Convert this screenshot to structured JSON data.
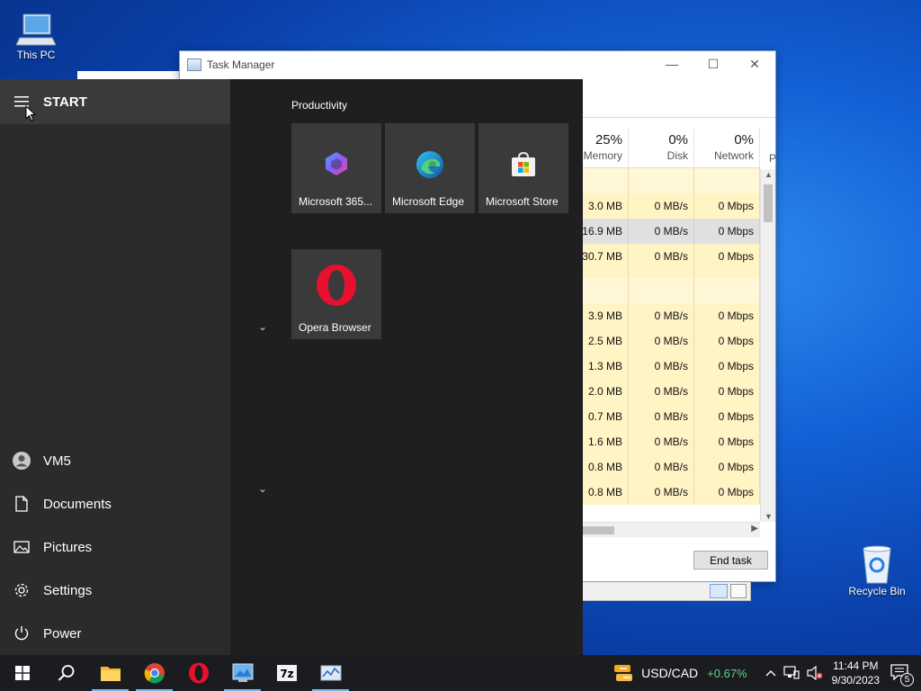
{
  "desktop": {
    "icons": [
      {
        "label": "This PC"
      },
      {
        "label": "Recycle Bin"
      }
    ]
  },
  "task_manager": {
    "title": "Task Manager",
    "columns": [
      {
        "pct": "25%",
        "label": "Memory"
      },
      {
        "pct": "0%",
        "label": "Disk"
      },
      {
        "pct": "0%",
        "label": "Network"
      }
    ],
    "truncated_column": "P",
    "rows": [
      {
        "memory": "",
        "disk": "",
        "network": ""
      },
      {
        "memory": "3.0 MB",
        "disk": "0 MB/s",
        "network": "0 Mbps"
      },
      {
        "memory": "16.9 MB",
        "disk": "0 MB/s",
        "network": "0 Mbps",
        "selected": true
      },
      {
        "memory": "30.7 MB",
        "disk": "0 MB/s",
        "network": "0 Mbps"
      },
      {
        "memory": "",
        "disk": "",
        "network": ""
      },
      {
        "memory": "3.9 MB",
        "disk": "0 MB/s",
        "network": "0 Mbps"
      },
      {
        "memory": "2.5 MB",
        "disk": "0 MB/s",
        "network": "0 Mbps"
      },
      {
        "memory": "1.3 MB",
        "disk": "0 MB/s",
        "network": "0 Mbps"
      },
      {
        "memory": "2.0 MB",
        "disk": "0 MB/s",
        "network": "0 Mbps"
      },
      {
        "memory": "0.7 MB",
        "disk": "0 MB/s",
        "network": "0 Mbps"
      },
      {
        "memory": "1.6 MB",
        "disk": "0 MB/s",
        "network": "0 Mbps"
      },
      {
        "memory": "0.8 MB",
        "disk": "0 MB/s",
        "network": "0 Mbps"
      },
      {
        "memory": "0.8 MB",
        "disk": "0 MB/s",
        "network": "0 Mbps"
      }
    ],
    "end_task_label": "End task",
    "controls": {
      "minimize": "—",
      "maximize": "☐",
      "close": "✕"
    }
  },
  "start_menu": {
    "header": "START",
    "left_items": [
      {
        "label": "VM5",
        "icon": "user-avatar-icon"
      },
      {
        "label": "Documents",
        "icon": "document-icon"
      },
      {
        "label": "Pictures",
        "icon": "pictures-icon"
      },
      {
        "label": "Settings",
        "icon": "gear-icon"
      },
      {
        "label": "Power",
        "icon": "power-icon"
      }
    ],
    "group_label": "Productivity",
    "tiles": [
      {
        "label": "Microsoft 365...",
        "icon": "microsoft-365-icon"
      },
      {
        "label": "Microsoft Edge",
        "icon": "edge-icon"
      },
      {
        "label": "Microsoft Store",
        "icon": "store-icon"
      },
      {
        "label": "Opera Browser",
        "icon": "opera-icon"
      }
    ]
  },
  "taskbar": {
    "apps": [
      "start",
      "search",
      "file-explorer",
      "chrome",
      "opera",
      "control-panel",
      "7zip",
      "task-manager"
    ],
    "ticker": {
      "symbol": "USD/CAD",
      "change": "+0.67%"
    },
    "clock": {
      "time": "11:44 PM",
      "date": "9/30/2023"
    },
    "notification_count": "5"
  },
  "colors": {
    "accent": "#76b9ed",
    "ticker_up": "#5ed38b",
    "tm_highlight": "#fff4c4"
  }
}
